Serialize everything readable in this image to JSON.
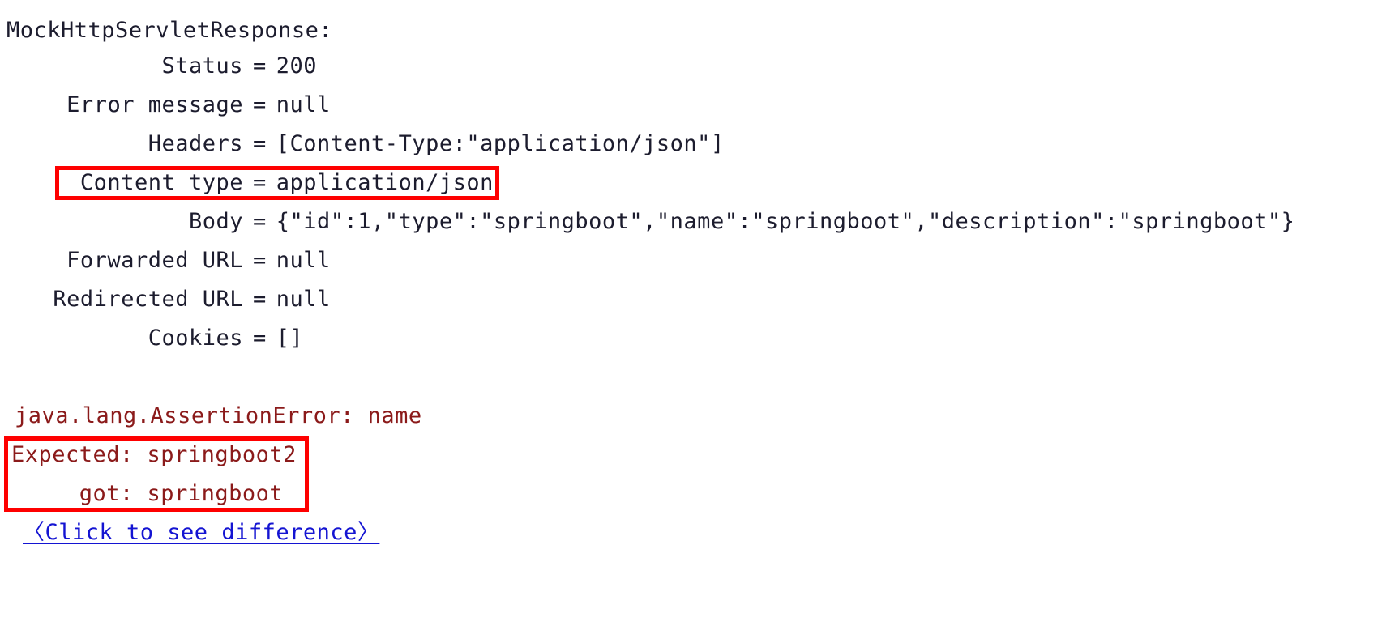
{
  "console": {
    "title": "MockHttpServletResponse:",
    "rows": [
      {
        "key": "Status",
        "eq": "=",
        "value": "200"
      },
      {
        "key": "Error message",
        "eq": "=",
        "value": "null"
      },
      {
        "key": "Headers",
        "eq": "=",
        "value": "[Content-Type:\"application/json\"]"
      },
      {
        "key": "Content type",
        "eq": "=",
        "value": "application/json"
      },
      {
        "key": "Body",
        "eq": "=",
        "value": "{\"id\":1,\"type\":\"springboot\",\"name\":\"springboot\",\"description\":\"springboot\"}"
      },
      {
        "key": "Forwarded URL",
        "eq": "=",
        "value": "null"
      },
      {
        "key": "Redirected URL",
        "eq": "=",
        "value": "null"
      },
      {
        "key": "Cookies",
        "eq": "=",
        "value": "[]"
      }
    ]
  },
  "error": {
    "exception_line": "java.lang.AssertionError: name",
    "expected_line": "Expected: springboot2",
    "got_line": "     got: springboot",
    "difference_link": "〈Click to see difference〉"
  },
  "annotations": {
    "content_type_box_label": "content-type-highlight",
    "assertion_box_label": "assertion-mismatch-highlight",
    "box_color": "#fe0000"
  },
  "colors": {
    "background": "#ffffff",
    "body_text": "#1c1c2e",
    "error_text": "#8b1a1a",
    "link_text": "#1414d2",
    "highlight": "#fe0000"
  }
}
